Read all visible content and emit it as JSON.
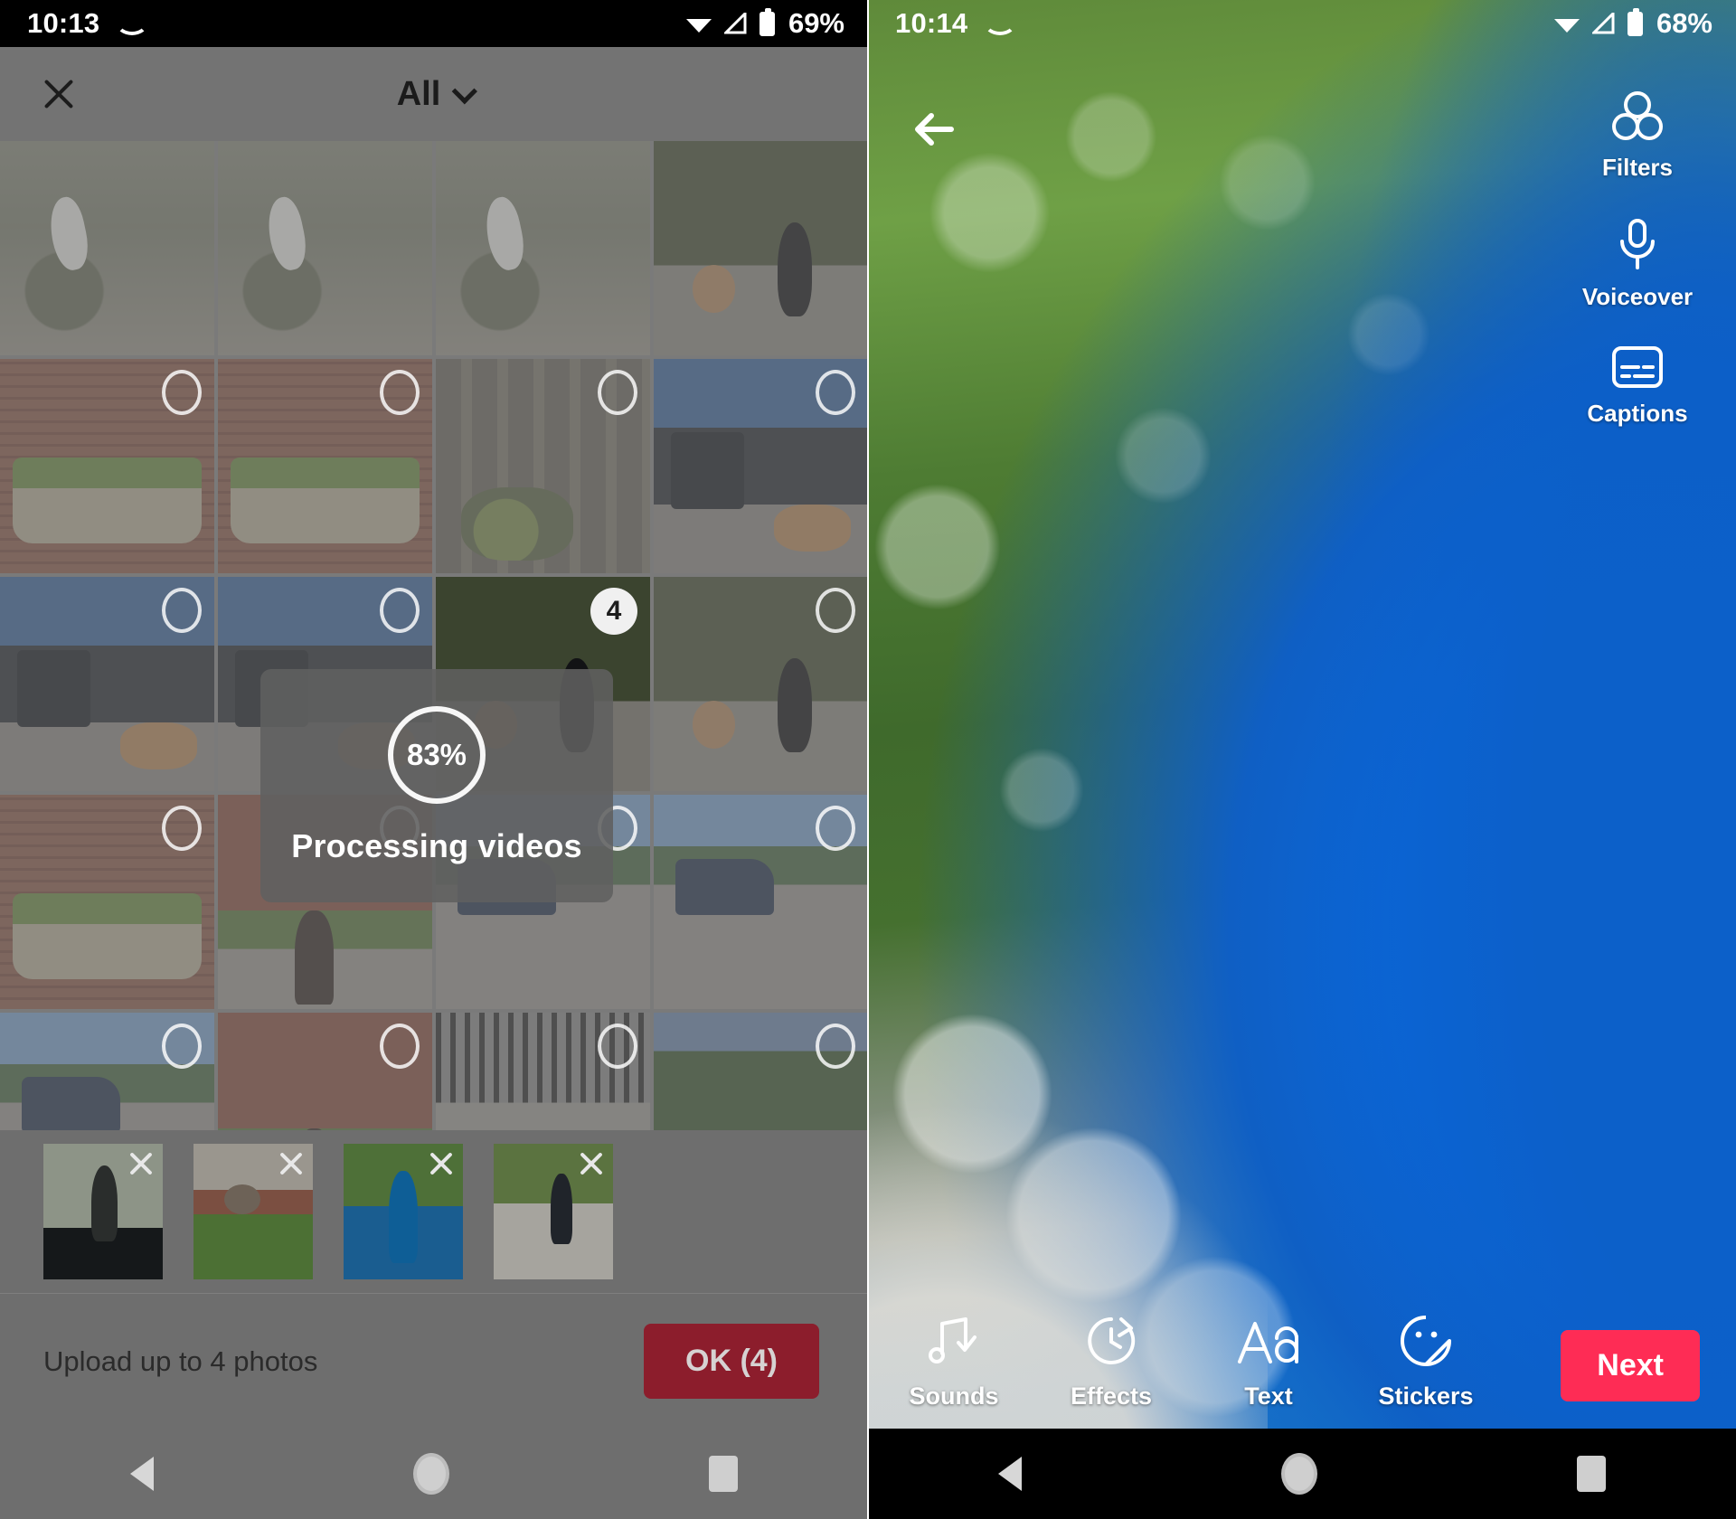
{
  "left_phone": {
    "status_bar": {
      "time": "10:13",
      "battery_percent": "69%",
      "icons": [
        "smile-icon",
        "wifi-icon",
        "signal-icon",
        "battery-icon"
      ]
    },
    "header": {
      "close_label": "close-icon",
      "album_title": "All",
      "dropdown_icon": "chevron-down-icon"
    },
    "grid": {
      "columns": 4,
      "cells": [
        {
          "art": "ph-grass",
          "selected": false,
          "badge": null
        },
        {
          "art": "ph-grass",
          "selected": false,
          "badge": null
        },
        {
          "art": "ph-grass",
          "selected": false,
          "badge": null
        },
        {
          "art": "ph-geese",
          "selected": false,
          "badge": null
        },
        {
          "art": "ph-brick",
          "selected": false,
          "badge": null
        },
        {
          "art": "ph-brick",
          "selected": false,
          "badge": null
        },
        {
          "art": "ph-fence",
          "selected": false,
          "badge": null
        },
        {
          "art": "ph-bin",
          "selected": false,
          "badge": null
        },
        {
          "art": "ph-bin",
          "selected": false,
          "badge": null
        },
        {
          "art": "ph-bin",
          "selected": false,
          "badge": null
        },
        {
          "art": "ph-geese",
          "selected": true,
          "badge": "4"
        },
        {
          "art": "ph-geese",
          "selected": false,
          "badge": null
        },
        {
          "art": "ph-brick",
          "selected": false,
          "badge": null
        },
        {
          "art": "ph-walk",
          "selected": false,
          "badge": null
        },
        {
          "art": "ph-street",
          "selected": false,
          "badge": null
        },
        {
          "art": "ph-street",
          "selected": false,
          "badge": null
        },
        {
          "art": "ph-street",
          "selected": false,
          "badge": null
        },
        {
          "art": "ph-walk",
          "selected": false,
          "badge": null
        },
        {
          "art": "ph-gate",
          "selected": false,
          "badge": null
        },
        {
          "art": "ph-trees",
          "selected": false,
          "badge": null
        },
        {
          "art": "ph-trees",
          "selected": false,
          "badge": null
        },
        {
          "art": "ph-trees",
          "selected": false,
          "badge": null
        },
        {
          "art": "ph-books",
          "selected": false,
          "badge": null
        },
        {
          "art": "ph-books",
          "selected": false,
          "badge": null
        }
      ]
    },
    "processing_dialog": {
      "percent_label": "83%",
      "percent_value": 83,
      "message": "Processing videos"
    },
    "selected_strip": {
      "remove_icon": "close-icon",
      "items": [
        {
          "art": "t1",
          "remove_label": "remove"
        },
        {
          "art": "t2",
          "remove_label": "remove"
        },
        {
          "art": "t3",
          "remove_label": "remove"
        },
        {
          "art": "t4",
          "remove_label": "remove"
        }
      ]
    },
    "footer": {
      "hint": "Upload up to 4 photos",
      "ok_label": "OK (4)",
      "ok_color": "#8c1d2c"
    },
    "nav_bar": {
      "back": "back-triangle-icon",
      "home": "home-circle-icon",
      "recents": "recents-square-icon"
    }
  },
  "right_phone": {
    "status_bar": {
      "time": "10:14",
      "battery_percent": "68%",
      "icons": [
        "smile-icon",
        "wifi-icon",
        "signal-icon",
        "battery-icon"
      ]
    },
    "back_button": "back-arrow-icon",
    "side_tools": [
      {
        "icon": "filters-icon",
        "label": "Filters"
      },
      {
        "icon": "microphone-icon",
        "label": "Voiceover"
      },
      {
        "icon": "captions-icon",
        "label": "Captions"
      }
    ],
    "bottom_tools": [
      {
        "icon": "music-note-check-icon",
        "label": "Sounds"
      },
      {
        "icon": "effects-clock-icon",
        "label": "Effects"
      },
      {
        "icon": "text-aa-icon",
        "label": "Text"
      },
      {
        "icon": "sticker-face-icon",
        "label": "Stickers"
      }
    ],
    "next_button": {
      "label": "Next",
      "color": "#fe2c55"
    },
    "nav_bar": {
      "back": "back-triangle-icon",
      "home": "home-circle-icon",
      "recents": "recents-square-icon"
    }
  }
}
